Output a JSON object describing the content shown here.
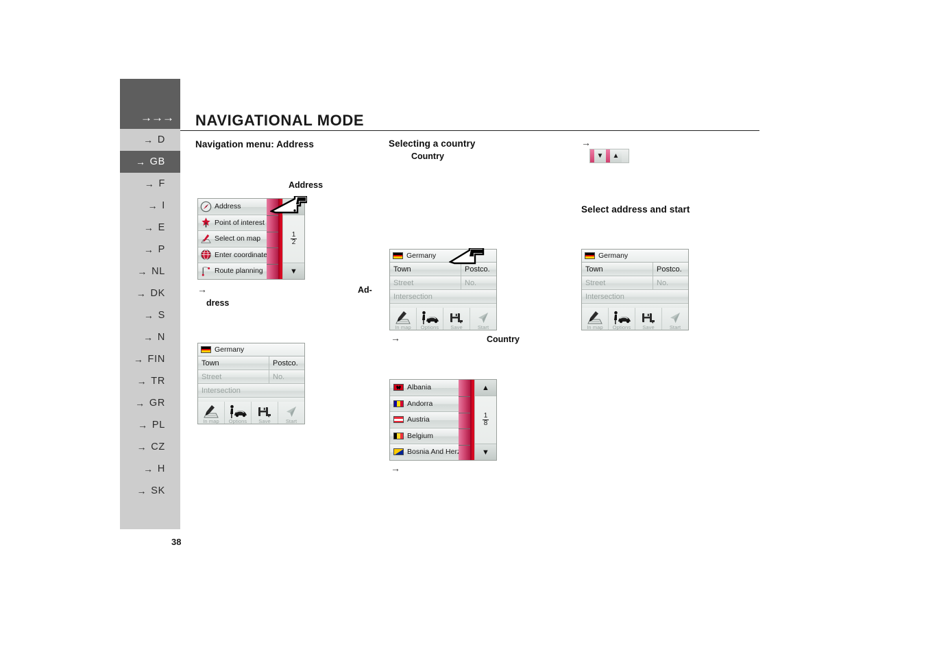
{
  "sidebar": {
    "header_arrows": "→→→",
    "items": [
      {
        "label": "D",
        "active": false
      },
      {
        "label": "GB",
        "active": true
      },
      {
        "label": "F",
        "active": false
      },
      {
        "label": "I",
        "active": false
      },
      {
        "label": "E",
        "active": false
      },
      {
        "label": "P",
        "active": false
      },
      {
        "label": "NL",
        "active": false
      },
      {
        "label": "DK",
        "active": false
      },
      {
        "label": "S",
        "active": false
      },
      {
        "label": "N",
        "active": false
      },
      {
        "label": "FIN",
        "active": false
      },
      {
        "label": "TR",
        "active": false
      },
      {
        "label": "GR",
        "active": false
      },
      {
        "label": "PL",
        "active": false
      },
      {
        "label": "CZ",
        "active": false
      },
      {
        "label": "H",
        "active": false
      },
      {
        "label": "SK",
        "active": false
      }
    ],
    "arrow_glyph": "→"
  },
  "header": {
    "title": "NAVIGATIONAL MODE"
  },
  "page_number": "38",
  "columns": {
    "left": {
      "heading": "Navigation menu: Address",
      "caption_address": "Address",
      "step_arrow": "→",
      "step_text_1": "Ad-",
      "step_text_2": "dress"
    },
    "middle": {
      "heading": "Selecting a country",
      "subheading": "Country",
      "step_arrow": "→",
      "step_label_country": "Country",
      "final_arrow": "→"
    },
    "right": {
      "top_arrow": "→",
      "heading": "Select address and start"
    }
  },
  "scroll_widget": {
    "down_glyph": "▼",
    "up_glyph": "▲"
  },
  "address_menu": {
    "items": [
      {
        "label": "Address",
        "icon": "compass-icon"
      },
      {
        "label": "Point of interest",
        "icon": "poi-pin-icon"
      },
      {
        "label": "Select on map",
        "icon": "map-cursor-icon"
      },
      {
        "label": "Enter coordinates",
        "icon": "globe-icon"
      },
      {
        "label": "Route planning",
        "icon": "route-flag-icon"
      }
    ],
    "page_num": "1",
    "page_den": "2",
    "down_glyph": "▼",
    "up_glyph": "▲"
  },
  "address_form": {
    "country": "Germany",
    "fields": {
      "town": "Town",
      "postcode": "Postco.",
      "street": "Street",
      "number": "No.",
      "intersection": "Intersection"
    },
    "buttons": [
      {
        "label": "In map",
        "icon": "in-map-icon"
      },
      {
        "label": "Options",
        "icon": "options-car-icon"
      },
      {
        "label": "Save",
        "icon": "save-disk-icon"
      },
      {
        "label": "Start",
        "icon": "start-arrow-icon"
      }
    ]
  },
  "country_list": {
    "items": [
      {
        "name": "Albania",
        "flag": "albania-flag"
      },
      {
        "name": "Andorra",
        "flag": "andorra-flag"
      },
      {
        "name": "Austria",
        "flag": "austria-flag"
      },
      {
        "name": "Belgium",
        "flag": "belgium-flag"
      },
      {
        "name": "Bosnia And Herze.",
        "flag": "bosnia-flag"
      }
    ],
    "page_num": "1",
    "page_den": "8",
    "down_glyph": "▼",
    "up_glyph": "▲"
  },
  "colors": {
    "sidebar_active": "#5e5e5e",
    "sidebar_inactive": "#cdcdcd",
    "accent_pink": "#d04070",
    "accent_red": "#cf0018"
  }
}
